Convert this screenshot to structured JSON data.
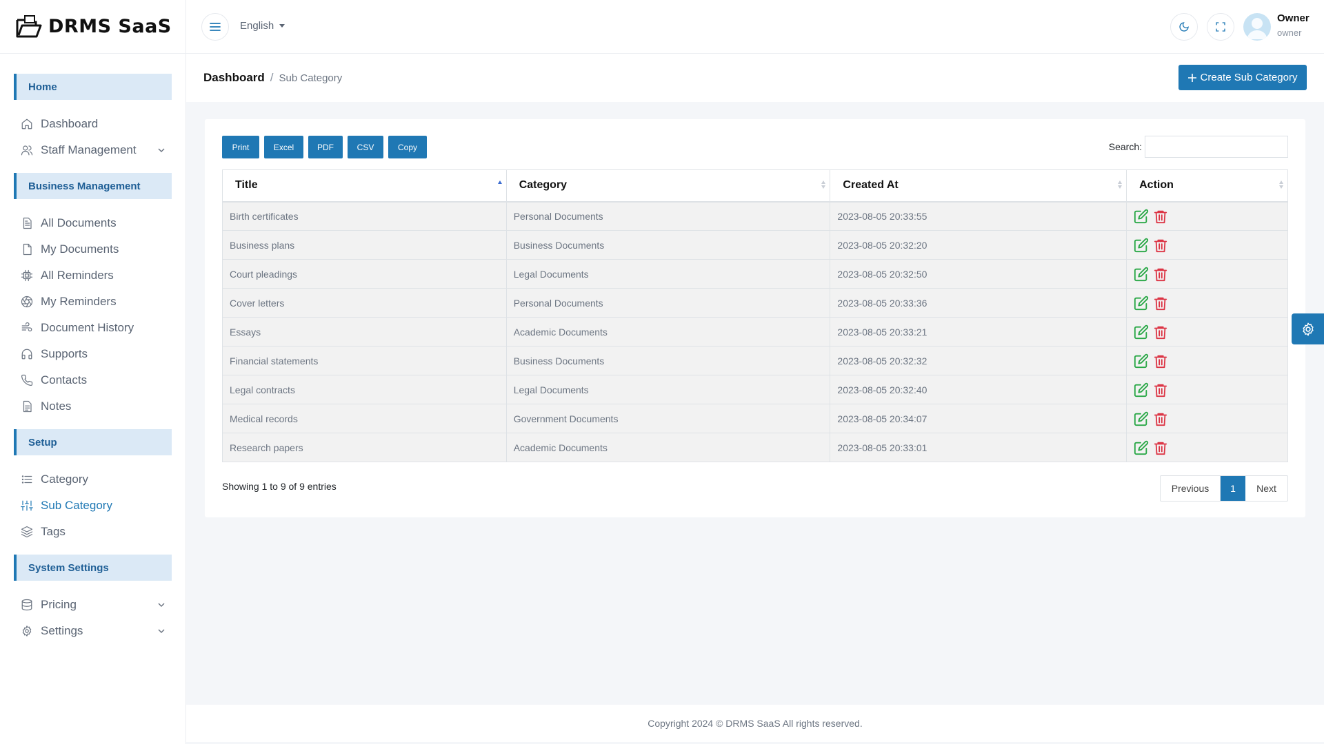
{
  "brand": {
    "name": "DRMS SaaS"
  },
  "sidebar": {
    "sections": [
      {
        "title": "Home",
        "items": [
          {
            "label": "Dashboard",
            "icon": "home-icon"
          },
          {
            "label": "Staff Management",
            "icon": "users-icon",
            "has_submenu": true
          }
        ]
      },
      {
        "title": "Business Management",
        "items": [
          {
            "label": "All Documents",
            "icon": "document-icon"
          },
          {
            "label": "My Documents",
            "icon": "file-icon"
          },
          {
            "label": "All Reminders",
            "icon": "cpu-icon"
          },
          {
            "label": "My Reminders",
            "icon": "aperture-icon"
          },
          {
            "label": "Document History",
            "icon": "wind-icon"
          },
          {
            "label": "Supports",
            "icon": "headphones-icon"
          },
          {
            "label": "Contacts",
            "icon": "phone-icon"
          },
          {
            "label": "Notes",
            "icon": "notes-icon"
          }
        ]
      },
      {
        "title": "Setup",
        "items": [
          {
            "label": "Category",
            "icon": "list-icon"
          },
          {
            "label": "Sub Category",
            "icon": "sliders-icon",
            "active": true
          },
          {
            "label": "Tags",
            "icon": "layers-icon"
          }
        ]
      },
      {
        "title": "System Settings",
        "items": [
          {
            "label": "Pricing",
            "icon": "database-icon",
            "has_submenu": true
          },
          {
            "label": "Settings",
            "icon": "gear-icon",
            "has_submenu": true
          }
        ]
      }
    ]
  },
  "topbar": {
    "language": "English",
    "user": {
      "name": "Owner",
      "role": "owner"
    }
  },
  "page": {
    "breadcrumb": {
      "home": "Dashboard",
      "separator": "/",
      "current": "Sub Category"
    },
    "create_button": "Create Sub Category"
  },
  "table_tools": {
    "buttons": [
      "Print",
      "Excel",
      "PDF",
      "CSV",
      "Copy"
    ],
    "search_label": "Search:",
    "search_value": ""
  },
  "table": {
    "columns": [
      "Title",
      "Category",
      "Created At",
      "Action"
    ],
    "rows": [
      {
        "title": "Birth certificates",
        "category": "Personal Documents",
        "created_at": "2023-08-05 20:33:55"
      },
      {
        "title": "Business plans",
        "category": "Business Documents",
        "created_at": "2023-08-05 20:32:20"
      },
      {
        "title": "Court pleadings",
        "category": "Legal Documents",
        "created_at": "2023-08-05 20:32:50"
      },
      {
        "title": "Cover letters",
        "category": "Personal Documents",
        "created_at": "2023-08-05 20:33:36"
      },
      {
        "title": "Essays",
        "category": "Academic Documents",
        "created_at": "2023-08-05 20:33:21"
      },
      {
        "title": "Financial statements",
        "category": "Business Documents",
        "created_at": "2023-08-05 20:32:32"
      },
      {
        "title": "Legal contracts",
        "category": "Legal Documents",
        "created_at": "2023-08-05 20:32:40"
      },
      {
        "title": "Medical records",
        "category": "Government Documents",
        "created_at": "2023-08-05 20:34:07"
      },
      {
        "title": "Research papers",
        "category": "Academic Documents",
        "created_at": "2023-08-05 20:33:01"
      }
    ],
    "info": "Showing 1 to 9 of 9 entries"
  },
  "pagination": {
    "previous": "Previous",
    "current": "1",
    "next": "Next"
  },
  "footer": {
    "text": "Copyright 2024 © DRMS SaaS All rights reserved."
  },
  "colors": {
    "primary": "#1f78b4",
    "edit": "#28a745",
    "delete": "#dc3545"
  }
}
